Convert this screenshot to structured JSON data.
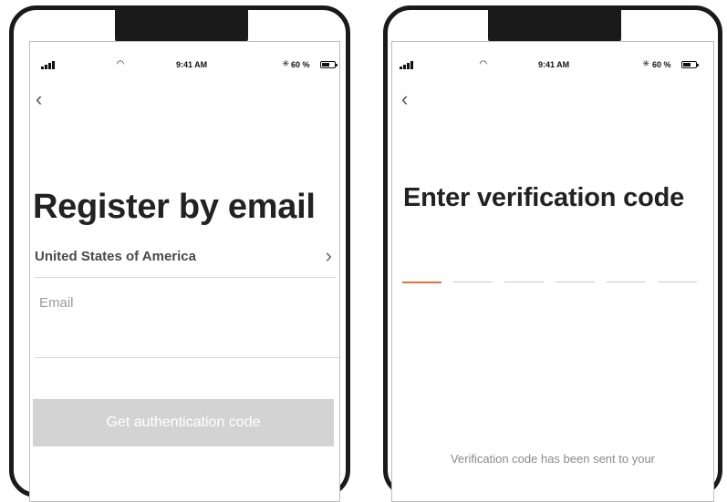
{
  "status_bar": {
    "time": "9:41 AM",
    "battery_pct": "60 %",
    "battery_level": 0.6
  },
  "register_screen": {
    "title": "Register by email",
    "country": "United States of America",
    "email_placeholder": "Email",
    "email_value": "",
    "auth_button_label": "Get authentication code"
  },
  "verify_screen": {
    "title": "Enter verification code",
    "code_digits": [
      "",
      "",
      "",
      "",
      "",
      ""
    ],
    "active_index": 0,
    "sent_message": "Verification code has been sent to your"
  },
  "colors": {
    "accent": "#e2703d",
    "button_disabled": "#d3d3d3",
    "text_dark": "#222222",
    "placeholder": "#9a9a9a"
  },
  "icons": {
    "back": "chevron-left-icon",
    "forward": "chevron-right-icon",
    "signal": "signal-icon",
    "wifi": "wifi-icon",
    "bluetooth": "bluetooth-icon",
    "battery": "battery-icon"
  }
}
